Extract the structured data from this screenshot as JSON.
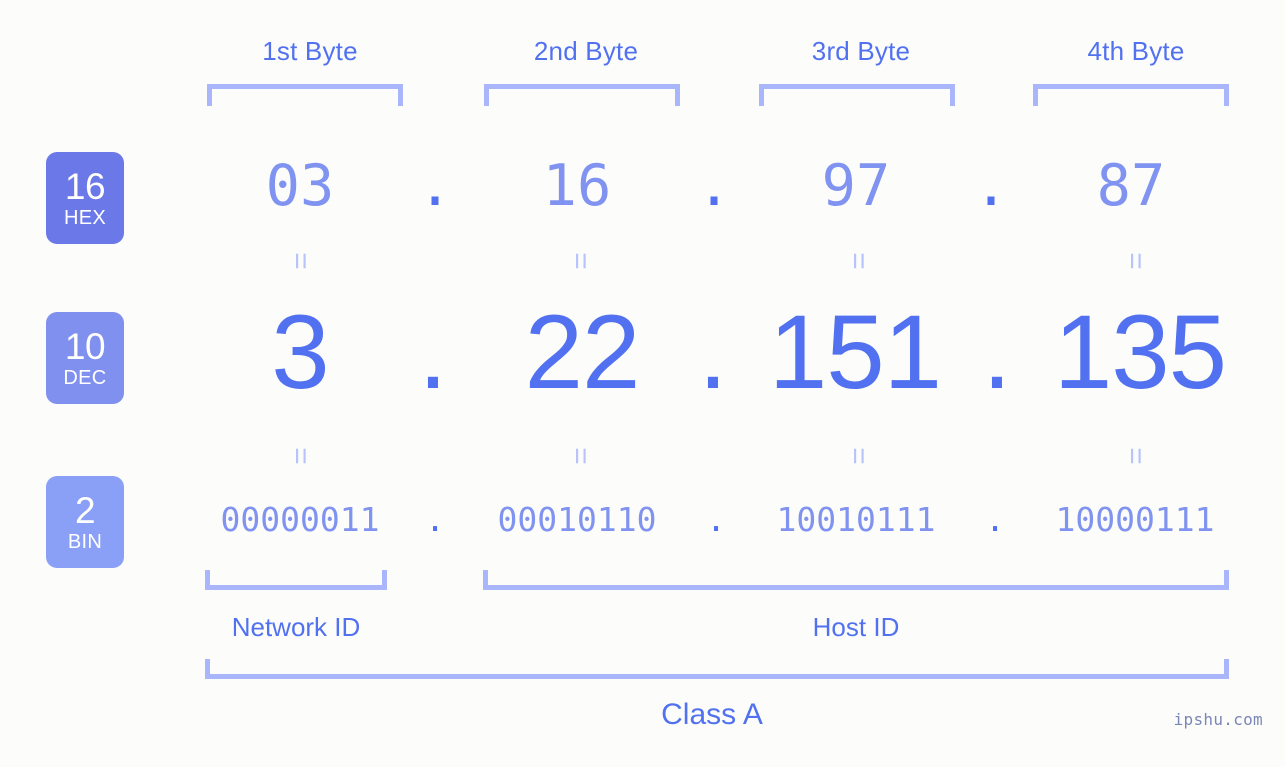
{
  "background_color": "#fcfdfa",
  "accent_color": "#5271f0",
  "accent_light_color": "#8193f0",
  "bracket_color": "#aab6fb",
  "byte_headers": [
    {
      "label": "1st Byte"
    },
    {
      "label": "2nd Byte"
    },
    {
      "label": "3rd Byte"
    },
    {
      "label": "4th Byte"
    }
  ],
  "rows": [
    {
      "badge_number": "16",
      "badge_abbr": "HEX",
      "badge_color": "#6b79e8",
      "values": [
        "03",
        "16",
        "97",
        "87"
      ],
      "separator": "."
    },
    {
      "badge_number": "10",
      "badge_abbr": "DEC",
      "badge_color": "#8090ef",
      "values": [
        "3",
        "22",
        "151",
        "135"
      ],
      "separator": "."
    },
    {
      "badge_number": "2",
      "badge_abbr": "BIN",
      "badge_color": "#8aa0f7",
      "values": [
        "00000011",
        "00010110",
        "10010111",
        "10000111"
      ],
      "separator": "."
    }
  ],
  "equals_symbol": "=",
  "segments": [
    {
      "label": "Network ID"
    },
    {
      "label": "Host ID"
    }
  ],
  "class_label": "Class A",
  "watermark": "ipshu.com",
  "ip_address": {
    "hex": "03.16.97.87",
    "dec": "3.22.151.135",
    "bin": "00000011.00010110.10010111.10000111"
  }
}
